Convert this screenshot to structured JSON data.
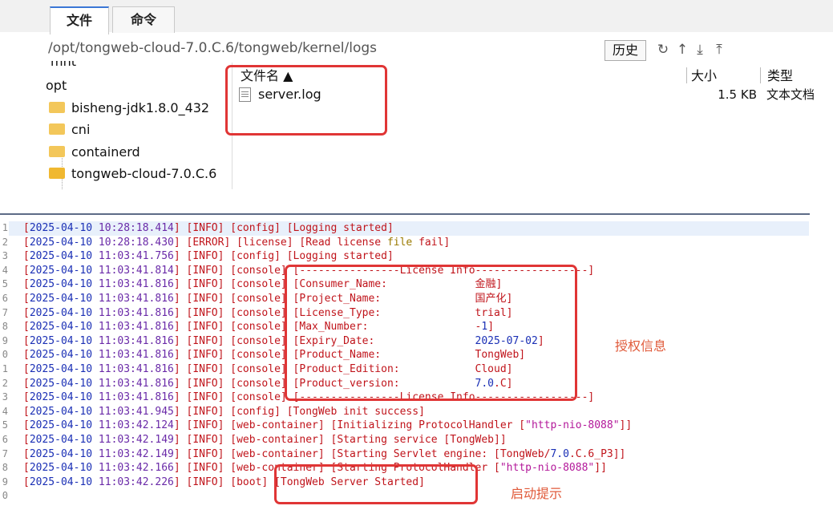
{
  "file_manager": {
    "tabs": [
      "文件",
      "命令"
    ],
    "path": "/opt/tongweb-cloud-7.0.C.6/tongweb/kernel/logs",
    "history_label": "历史",
    "toolbar_icons": [
      "refresh-icon",
      "up-icon",
      "download-icon",
      "upload-icon"
    ],
    "tree": [
      "mnt",
      "opt",
      "bisheng-jdk1.8.0_432",
      "cni",
      "containerd",
      "tongweb-cloud-7.0.C.6"
    ],
    "columns": {
      "name": "文件名 ▲",
      "size": "大小",
      "type": "类型"
    },
    "files": [
      {
        "name": "server.log",
        "size": "1.5 KB",
        "type": "文本文档"
      }
    ]
  },
  "log": {
    "line_numbers": [
      "1",
      "2",
      "3",
      "4",
      "5",
      "6",
      "7",
      "8",
      "9",
      "0",
      "1",
      "2",
      "3",
      "4",
      "5",
      "6",
      "7",
      "8",
      "9",
      "0"
    ],
    "lines": [
      [
        [
          "br",
          "["
        ],
        [
          "date",
          "2025-04-10 "
        ],
        [
          "time",
          "10:28:18.414"
        ],
        [
          "br",
          "] [INFO] [config] [Logging started]"
        ]
      ],
      [
        [
          "br",
          "["
        ],
        [
          "date",
          "2025-04-10 "
        ],
        [
          "time",
          "10:28:18.430"
        ],
        [
          "br",
          "] [ERROR] [license] [Read license "
        ],
        [
          "kw",
          "file"
        ],
        [
          "br",
          " fail]"
        ]
      ],
      [
        [
          "br",
          "["
        ],
        [
          "date",
          "2025-04-10 "
        ],
        [
          "time",
          "11:03:41.756"
        ],
        [
          "br",
          "] [INFO] [config] [Logging started]"
        ]
      ],
      [
        [
          "br",
          "["
        ],
        [
          "date",
          "2025-04-10 "
        ],
        [
          "time",
          "11:03:41.814"
        ],
        [
          "br",
          "] [INFO] [console] [----------------License Info------------------]"
        ]
      ],
      [
        [
          "br",
          "["
        ],
        [
          "date",
          "2025-04-10 "
        ],
        [
          "time",
          "11:03:41.816"
        ],
        [
          "br",
          "] [INFO] [console] [Consumer_Name:              金融]"
        ]
      ],
      [
        [
          "br",
          "["
        ],
        [
          "date",
          "2025-04-10 "
        ],
        [
          "time",
          "11:03:41.816"
        ],
        [
          "br",
          "] [INFO] [console] [Project_Name:               国产化]"
        ]
      ],
      [
        [
          "br",
          "["
        ],
        [
          "date",
          "2025-04-10 "
        ],
        [
          "time",
          "11:03:41.816"
        ],
        [
          "br",
          "] [INFO] [console] [License_Type:               trial]"
        ]
      ],
      [
        [
          "br",
          "["
        ],
        [
          "date",
          "2025-04-10 "
        ],
        [
          "time",
          "11:03:41.816"
        ],
        [
          "br",
          "] [INFO] [console] [Max_Number:                 -"
        ],
        [
          "num",
          "1"
        ],
        [
          "br",
          "]"
        ]
      ],
      [
        [
          "br",
          "["
        ],
        [
          "date",
          "2025-04-10 "
        ],
        [
          "time",
          "11:03:41.816"
        ],
        [
          "br",
          "] [INFO] [console] [Expiry_Date:                "
        ],
        [
          "num",
          "2025-07-02"
        ],
        [
          "br",
          "]"
        ]
      ],
      [
        [
          "br",
          "["
        ],
        [
          "date",
          "2025-04-10 "
        ],
        [
          "time",
          "11:03:41.816"
        ],
        [
          "br",
          "] [INFO] [console] [Product_Name:               TongWeb]"
        ]
      ],
      [
        [
          "br",
          "["
        ],
        [
          "date",
          "2025-04-10 "
        ],
        [
          "time",
          "11:03:41.816"
        ],
        [
          "br",
          "] [INFO] [console] [Product_Edition:            Cloud]"
        ]
      ],
      [
        [
          "br",
          "["
        ],
        [
          "date",
          "2025-04-10 "
        ],
        [
          "time",
          "11:03:41.816"
        ],
        [
          "br",
          "] [INFO] [console] [Product_version:            "
        ],
        [
          "num",
          "7.0"
        ],
        [
          "br",
          ".C]"
        ]
      ],
      [
        [
          "br",
          "["
        ],
        [
          "date",
          "2025-04-10 "
        ],
        [
          "time",
          "11:03:41.816"
        ],
        [
          "br",
          "] [INFO] [console] [----------------License Info------------------]"
        ]
      ],
      [
        [
          "br",
          "["
        ],
        [
          "date",
          "2025-04-10 "
        ],
        [
          "time",
          "11:03:41.945"
        ],
        [
          "br",
          "] [INFO] [config] [TongWeb init success]"
        ]
      ],
      [
        [
          "br",
          "["
        ],
        [
          "date",
          "2025-04-10 "
        ],
        [
          "time",
          "11:03:42.124"
        ],
        [
          "br",
          "] [INFO] [web-container] [Initializing ProtocolHandler ["
        ],
        [
          "str",
          "\"http-nio-8088\""
        ],
        [
          "br",
          "]]"
        ]
      ],
      [
        [
          "br",
          "["
        ],
        [
          "date",
          "2025-04-10 "
        ],
        [
          "time",
          "11:03:42.149"
        ],
        [
          "br",
          "] [INFO] [web-container] [Starting service [TongWeb]]"
        ]
      ],
      [
        [
          "br",
          "["
        ],
        [
          "date",
          "2025-04-10 "
        ],
        [
          "time",
          "11:03:42.149"
        ],
        [
          "br",
          "] [INFO] [web-container] [Starting Servlet engine: [TongWeb/"
        ],
        [
          "num",
          "7.0"
        ],
        [
          "br",
          ".C.6_P3]]"
        ]
      ],
      [
        [
          "br",
          "["
        ],
        [
          "date",
          "2025-04-10 "
        ],
        [
          "time",
          "11:03:42.166"
        ],
        [
          "br",
          "] [INFO] [web-container] [Starting ProtocolHandler ["
        ],
        [
          "str",
          "\"http-nio-8088\""
        ],
        [
          "br",
          "]]"
        ]
      ],
      [
        [
          "br",
          "["
        ],
        [
          "date",
          "2025-04-10 "
        ],
        [
          "time",
          "11:03:42.226"
        ],
        [
          "br",
          "] [INFO] [boot] [TongWeb Server Started]"
        ]
      ],
      [
        [
          "br",
          ""
        ]
      ]
    ]
  },
  "annotations": {
    "license_label": "授权信息",
    "startup_label": "启动提示"
  },
  "colors": {
    "highlight": "#e03535",
    "annotation_text": "#e05a3a"
  }
}
